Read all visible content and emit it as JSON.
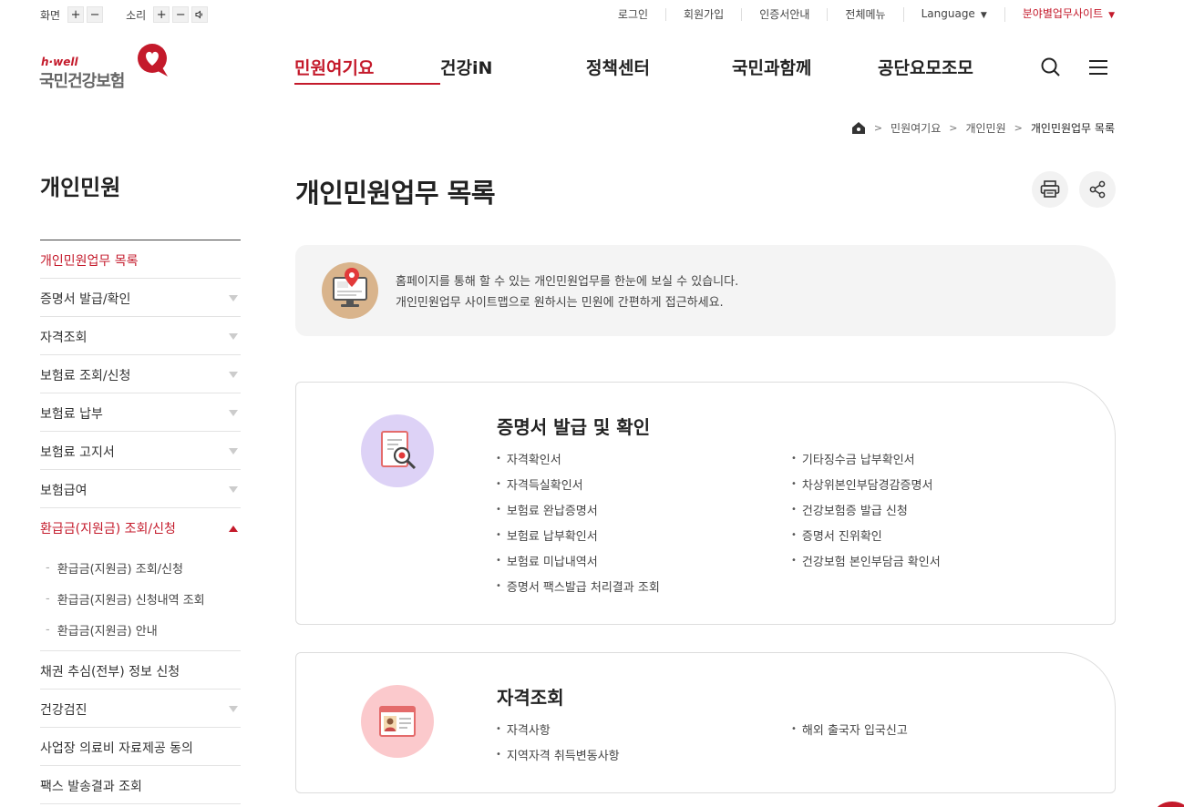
{
  "utility": {
    "screen_label": "화면",
    "sound_label": "소리",
    "plus": "+",
    "minus": "−",
    "links": [
      "로그인",
      "회원가입",
      "인증서안내",
      "전체메뉴",
      "Language"
    ],
    "special_link": "분야별업무사이트"
  },
  "logo": {
    "tagline": "h·well",
    "name": "국민건강보험"
  },
  "gnb": [
    "민원여기요",
    "건강iN",
    "정책센터",
    "국민과함께",
    "공단요모조모"
  ],
  "breadcrumb": [
    "민원여기요",
    "개인민원",
    "개인민원업무 목록"
  ],
  "lnb": {
    "title": "개인민원",
    "items": [
      {
        "label": "개인민원업무 목록",
        "state": "active",
        "arrow": false
      },
      {
        "label": "증명서 발급/확인",
        "state": "normal",
        "arrow": true
      },
      {
        "label": "자격조회",
        "state": "normal",
        "arrow": true
      },
      {
        "label": "보험료 조회/신청",
        "state": "normal",
        "arrow": true
      },
      {
        "label": "보험료 납부",
        "state": "normal",
        "arrow": true
      },
      {
        "label": "보험료 고지서",
        "state": "normal",
        "arrow": true
      },
      {
        "label": "보험급여",
        "state": "normal",
        "arrow": true
      },
      {
        "label": "환급금(지원금) 조회/신청",
        "state": "open",
        "arrow": true
      }
    ],
    "subitems": [
      "환급금(지원금) 조회/신청",
      "환급금(지원금) 신청내역 조회",
      "환급금(지원금) 안내"
    ],
    "items_after": [
      {
        "label": "채권 추심(전부) 정보 신청",
        "arrow": false
      },
      {
        "label": "건강검진",
        "arrow": true
      },
      {
        "label": "사업장 의료비 자료제공 동의",
        "arrow": false
      },
      {
        "label": "팩스 발송결과 조회",
        "arrow": false
      }
    ]
  },
  "main": {
    "title": "개인민원업무 목록",
    "notice_line1": "홈페이지를 통해 할 수 있는 개인민원업무를 한눈에 보실 수 있습니다.",
    "notice_line2": "개인민원업무 사이트맵으로 원하시는 민원에 간편하게 접근하세요."
  },
  "cards": [
    {
      "title": "증명서 발급 및 확인",
      "left": [
        "자격확인서",
        "자격득실확인서",
        "보험료 완납증명서",
        "보험료 납부확인서",
        "보험료 미납내역서",
        "증명서 팩스발급 처리결과 조회"
      ],
      "right": [
        "기타징수금 납부확인서",
        "차상위본인부담경감증명서",
        "건강보험증 발급 신청",
        "증명서 진위확인",
        "건강보험 본인부담금 확인서"
      ]
    },
    {
      "title": "자격조회",
      "left": [
        "자격사항",
        "지역자격 취득변동사항"
      ],
      "right": [
        "해외 출국자 입국신고"
      ]
    }
  ],
  "colors": {
    "brand_red": "#c41a2b",
    "notice_bg": "#f4f4f4"
  }
}
